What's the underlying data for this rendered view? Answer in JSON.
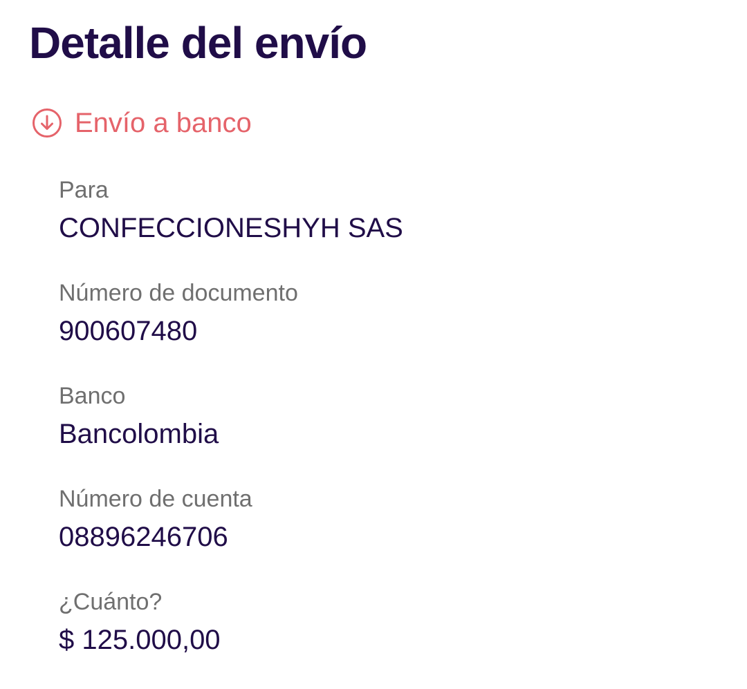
{
  "page": {
    "title": "Detalle del envío"
  },
  "transfer": {
    "type_label": "Envío a banco",
    "icon": "arrow-down-circle-icon",
    "accent_color": "#e5636a"
  },
  "details": [
    {
      "label": "Para",
      "value": "CONFECCIONESHYH SAS"
    },
    {
      "label": "Número de documento",
      "value": "900607480"
    },
    {
      "label": "Banco",
      "value": "Bancolombia"
    },
    {
      "label": "Número de cuenta",
      "value": "08896246706"
    },
    {
      "label": "¿Cuánto?",
      "value": "$ 125.000,00"
    }
  ],
  "colors": {
    "title": "#200d48",
    "label": "#6f6f6f",
    "value": "#200d48"
  }
}
